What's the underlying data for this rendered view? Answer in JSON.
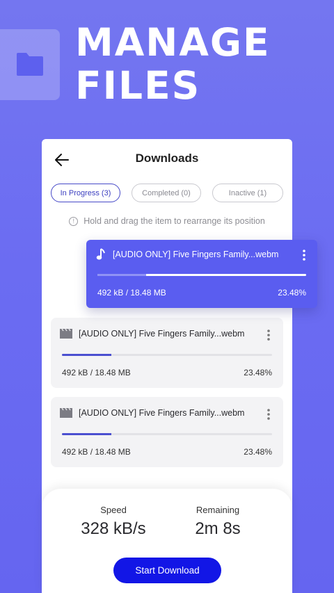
{
  "hero": {
    "title_line1": "MANAGE",
    "title_line2": "FILES",
    "icon": "folder-icon"
  },
  "screen": {
    "title": "Downloads",
    "back_icon": "arrow-left-icon"
  },
  "tabs": [
    {
      "label": "In Progress (3)",
      "active": true
    },
    {
      "label": "Completed (0)",
      "active": false
    },
    {
      "label": "Inactive (1)",
      "active": false
    }
  ],
  "hint": {
    "icon": "info-icon",
    "text": "Hold and drag the item to rearrange its position"
  },
  "downloads": [
    {
      "name": "[AUDIO ONLY] Five Fingers Family...webm",
      "icon": "music-note-icon",
      "size": "492 kB / 18.48 MB",
      "percent": "23.48%",
      "progress": 0.2348,
      "dragging": true
    },
    {
      "name": "[AUDIO ONLY] Five Fingers Family...webm",
      "icon": "video-clapper-icon",
      "size": "492 kB / 18.48 MB",
      "percent": "23.48%",
      "progress": 0.2348,
      "dragging": false
    },
    {
      "name": "[AUDIO ONLY] Five Fingers Family...webm",
      "icon": "video-clapper-icon",
      "size": "492 kB / 18.48 MB",
      "percent": "23.48%",
      "progress": 0.2348,
      "dragging": false
    }
  ],
  "stats": {
    "speed_label": "Speed",
    "speed_value": "328 kB/s",
    "remaining_label": "Remaining",
    "remaining_value": "2m 8s"
  },
  "actions": {
    "start_label": "Start Download"
  },
  "colors": {
    "background": "#6b6cf2",
    "accent": "#1216e6",
    "drag_card": "#5a5df0",
    "progress": "#4b4fd0"
  }
}
